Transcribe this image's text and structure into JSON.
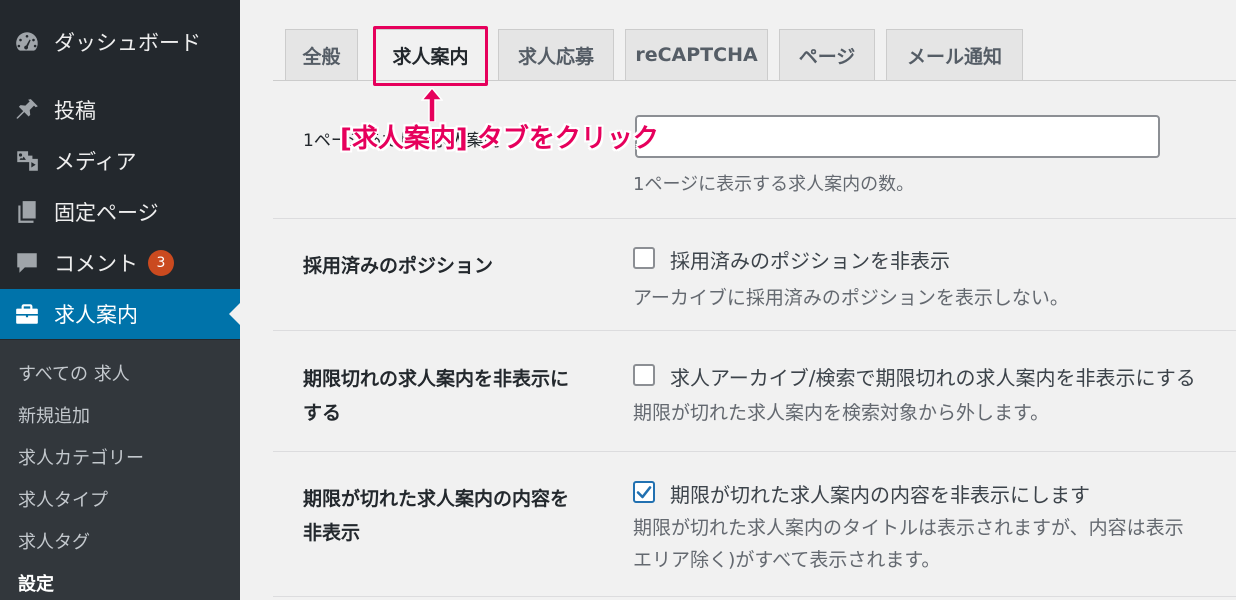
{
  "sidebar": {
    "items": [
      {
        "label": "ダッシュボード",
        "icon": "dashboard-icon"
      },
      {
        "label": "投稿",
        "icon": "pin-icon"
      },
      {
        "label": "メディア",
        "icon": "media-icon"
      },
      {
        "label": "固定ページ",
        "icon": "pages-icon"
      },
      {
        "label": "コメント",
        "icon": "comment-icon",
        "badge": "3"
      },
      {
        "label": "求人案内",
        "icon": "briefcase-icon"
      }
    ],
    "submenu": [
      "すべての 求人",
      "新規追加",
      "求人カテゴリー",
      "求人タイプ",
      "求人タグ",
      "設定"
    ]
  },
  "tabs": [
    "全般",
    "求人案内",
    "求人応募",
    "reCAPTCHA",
    "ページ",
    "メール通知"
  ],
  "annotation": "[求人案内] タブをクリック",
  "settings": {
    "per_page": {
      "label": "1ページあたりの求人案内",
      "value": "",
      "description": "1ページに表示する求人案内の数。"
    },
    "filled": {
      "label": "採用済みのポジション",
      "checkbox": "採用済みのポジションを非表示",
      "checked": false,
      "description": "アーカイブに採用済みのポジションを表示しない。"
    },
    "expired": {
      "label_line1": "期限切れの求人案内を非表示に",
      "label_line2": "する",
      "checkbox": "求人アーカイブ/検索で期限切れの求人案内を非表示にする",
      "checked": false,
      "description": "期限が切れた求人案内を検索対象から外します。"
    },
    "expired_content": {
      "label_line1": "期限が切れた求人案内の内容を",
      "label_line2": "非表示",
      "checkbox": "期限が切れた求人案内の内容を非表示にします",
      "checked": true,
      "description_line1": "期限が切れた求人案内のタイトルは表示されますが、内容は表示",
      "description_line2": "エリア除く)がすべて表示されます。"
    }
  },
  "colors": {
    "sidebar": "#23282d",
    "active": "#0073aa",
    "highlight": "#e6005c",
    "checkbox_checked": "#2271b1"
  }
}
